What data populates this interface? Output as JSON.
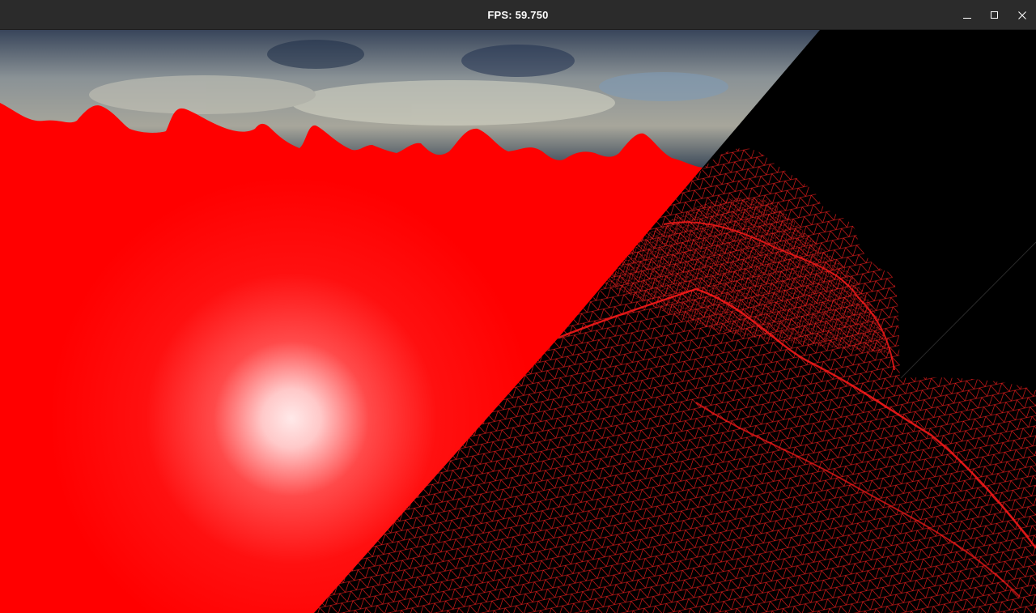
{
  "window": {
    "title": "FPS: 59.750",
    "controls": {
      "minimize_icon": "minimize-icon",
      "maximize_icon": "maximize-icon",
      "close_icon": "close-icon"
    }
  },
  "scene": {
    "skybox": "water-skybox",
    "solid_mesh_color": "#ff0000",
    "wireframe_color": "#ff1a1a",
    "highlight_color": "#ffffff",
    "background_color": "#000000"
  },
  "colors": {
    "titlebar": "#2b2b2b",
    "title_text": "#ffffff"
  }
}
